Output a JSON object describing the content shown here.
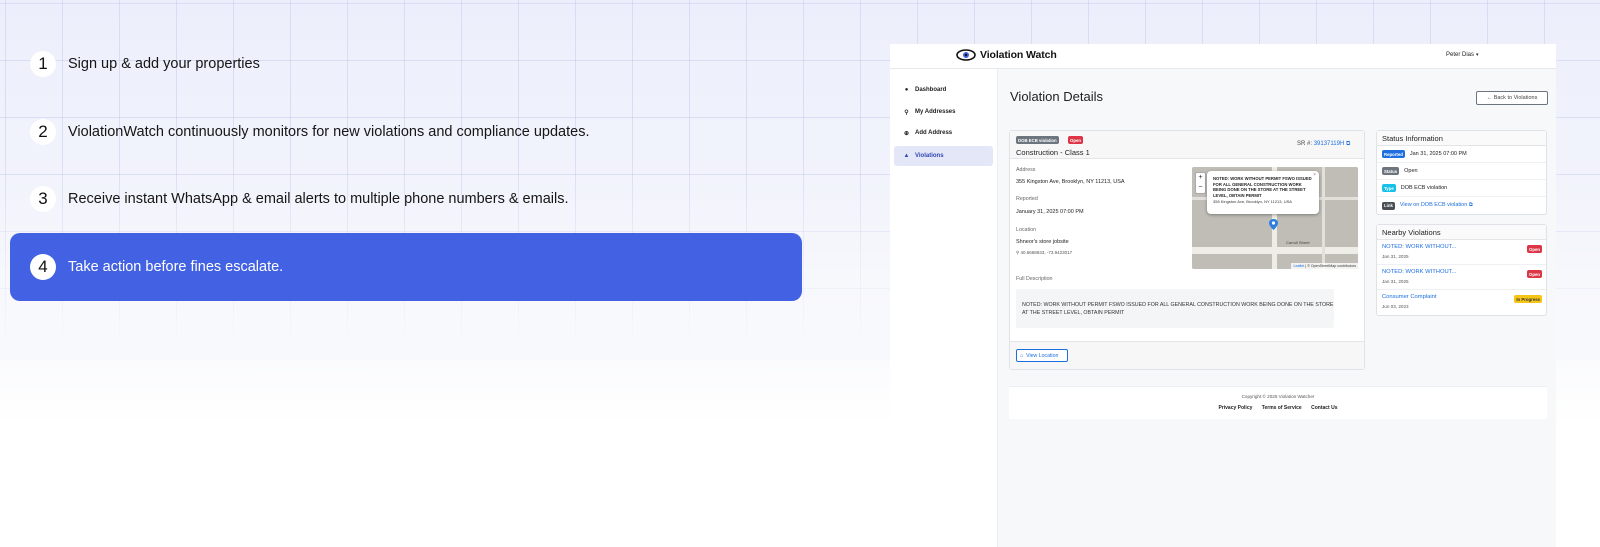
{
  "steps": [
    {
      "number": "1",
      "text": "Sign up & add your properties",
      "active": false
    },
    {
      "number": "2",
      "text": "ViolationWatch continuously monitors for new violations and compliance updates.",
      "active": false
    },
    {
      "number": "3",
      "text": "Receive instant WhatsApp & email alerts to multiple phone numbers & emails.",
      "active": false
    },
    {
      "number": "4",
      "text": "Take action before fines escalate.",
      "active": true
    }
  ],
  "app": {
    "brand": "Violation Watch",
    "user": "Peter Dias",
    "user_caret": "▾",
    "nav": [
      {
        "icon": "●",
        "label": "Dashboard"
      },
      {
        "icon": "⚲",
        "label": "My Addresses"
      },
      {
        "icon": "⊕",
        "label": "Add Address"
      },
      {
        "icon": "▲",
        "label": "Violations"
      }
    ],
    "page_title": "Violation Details",
    "back_button": "← Back to Violations",
    "violation": {
      "badge_type": "DOB ECB violation",
      "badge_status": "Open",
      "title": "Construction - Class 1",
      "sr_label": "SR #:",
      "sr_number": "39137119H",
      "sr_icon": "⧉",
      "address_label": "Address",
      "address": "355 Kingston Ave, Brooklyn, NY 11213, USA",
      "reported_label": "Reported",
      "reported": "January 31, 2025 07:00 PM",
      "location_label": "Location",
      "location_name": "Shneor's store jobsite",
      "coordinates": "40.6668843, -73.9423017",
      "full_description_label": "Full Description",
      "full_description": "NOTED: WORK WITHOUT PERMIT FSWO ISSUED FOR ALL GENERAL CONSTRUCTION WORK BEING DONE ON THE STORE AT THE STREET LEVEL, OBTAIN PERMIT",
      "view_location_button": "View Location"
    },
    "map": {
      "zoom_in": "+",
      "zoom_out": "−",
      "popup_title": "NOTED: WORK WITHOUT PERMIT FSWO ISSUED FOR ALL GENERAL CONSTRUCTION WORK BEING DONE ON THE STORE AT THE STREET LEVEL, OBTAIN PERMIT",
      "popup_address": "355 Kingston Ave, Brooklyn, NY 11213, USA",
      "popup_close": "×",
      "street_label": "Carroll Street",
      "attribution_leaflet": "Leaflet",
      "attribution_rest": " | © OpenStreetMap contributors"
    },
    "status_info": {
      "title": "Status Information",
      "rows": [
        {
          "badge": "Reported",
          "value": "Jan 31, 2025 07:00 PM",
          "badge_color": "#1d6fe0",
          "link": false
        },
        {
          "badge": "Status",
          "value": "Open",
          "badge_color": "#6c757d",
          "link": false
        },
        {
          "badge": "Type",
          "value": "DOB ECB violation",
          "badge_color": "#17c1e8",
          "link": false
        },
        {
          "badge": "Link",
          "value": "View on DOB ECB violation ⧉",
          "badge_color": "#4a4f55",
          "link": true
        }
      ]
    },
    "nearby": {
      "title": "Nearby Violations",
      "items": [
        {
          "title": "NOTED: WORK WITHOUT...",
          "date": "Jan 31, 2025",
          "badge": "Open",
          "badge_color": "#dc3545"
        },
        {
          "title": "NOTED: WORK WITHOUT...",
          "date": "Jan 31, 2025",
          "badge": "Open",
          "badge_color": "#dc3545"
        },
        {
          "title": "Consumer Complaint",
          "date": "Jun 03, 2023",
          "badge": "In Progress",
          "badge_color": "#f5c518"
        }
      ]
    },
    "footer": {
      "copyright": "Copyright © 2025 Violation Watcher",
      "links": [
        "Privacy Policy",
        "Terms of Service",
        "Contact Us"
      ]
    }
  },
  "colors": {
    "accent": "#4361e3",
    "link": "#1d6fe0",
    "danger": "#dc3545"
  }
}
